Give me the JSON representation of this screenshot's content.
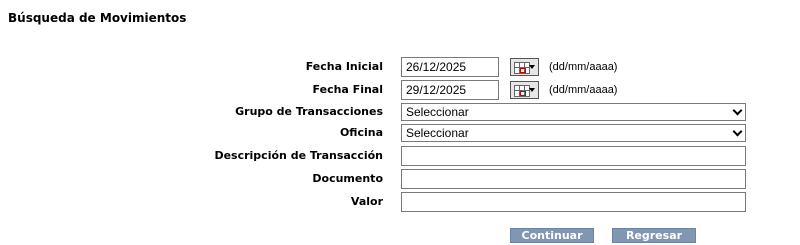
{
  "page": {
    "title": "Búsqueda de Movimientos"
  },
  "form": {
    "fecha_inicial": {
      "label": "Fecha Inicial",
      "value": "26/12/2025",
      "format_hint": "(dd/mm/aaaa)"
    },
    "fecha_final": {
      "label": "Fecha Final",
      "value": "29/12/2025",
      "format_hint": "(dd/mm/aaaa)"
    },
    "grupo_transacciones": {
      "label": "Grupo de Transacciones",
      "selected": "Seleccionar"
    },
    "oficina": {
      "label": "Oficina",
      "selected": "Seleccionar"
    },
    "descripcion": {
      "label": "Descripción de Transacción",
      "value": ""
    },
    "documento": {
      "label": "Documento",
      "value": ""
    },
    "valor": {
      "label": "Valor",
      "value": ""
    }
  },
  "actions": {
    "continuar": "Continuar",
    "regresar": "Regresar"
  },
  "icons": {
    "calendar": "calendar-icon",
    "dropdown": "chevron-down-icon"
  },
  "colors": {
    "button_bg": "#8196b3",
    "button_text": "#ffffff"
  }
}
